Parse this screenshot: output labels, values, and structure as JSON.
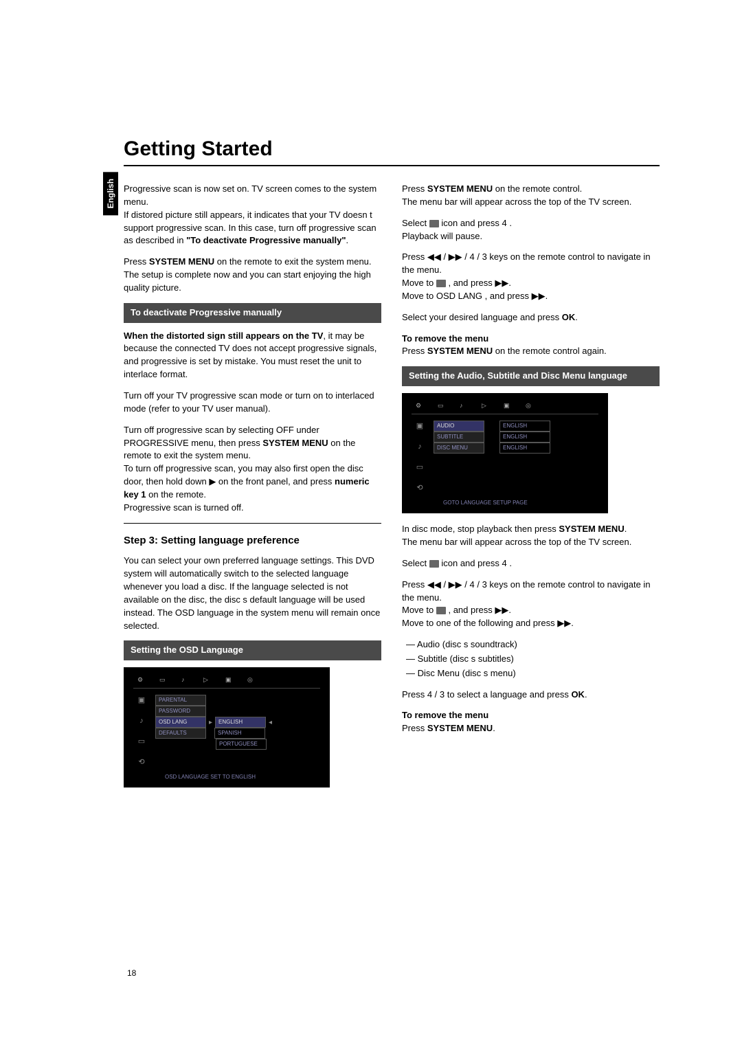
{
  "langTab": "English",
  "title": "Getting Started",
  "pageNumber": "18",
  "left": {
    "p1a": "Progressive scan is now set on. TV screen comes to the system menu.",
    "p1b": "If distored picture still appears, it indicates that your TV doesn t support progressive scan. In this case, turn off progressive scan as described in ",
    "p1b_bold": "\"To deactivate Progressive manually\"",
    "p1b_end": ".",
    "p2a": "Press ",
    "p2a_bold": "SYSTEM MENU",
    "p2a_end": " on the remote to exit the system menu.",
    "p2b": "The setup is complete now and you can start enjoying the high quality picture.",
    "sub1": "To deactivate Progressive manually",
    "p3_bold": "When the distorted sign still appears on the TV",
    "p3_end": ", it may be because the connected TV does not accept progressive signals, and progressive is set by mistake. You must reset the unit to interlace format.",
    "p4": "Turn off your TV progressive scan mode or turn on to interlaced mode (refer to your TV user manual).",
    "p5a": "Turn off progressive scan by selecting  OFF under PROGRESSIVE menu, then press ",
    "p5a_bold": "SYSTEM MENU",
    "p5a_end": " on the remote to exit the system menu.",
    "p5b": "To turn off progressive scan, you may also first open the disc door, then hold down ▶ on the front panel, and press ",
    "p5b_bold": "numeric key  1 ",
    "p5b_end": " on the remote.",
    "p5c": "Progressive scan is turned off.",
    "stepHeading": "Step 3:   Setting language preference",
    "p6": "You can select your own preferred language settings. This DVD system will automatically switch to the selected language whenever you load a disc. If the language selected is not available on the disc, the disc s default language will be used instead. The OSD language in the system menu will remain once selected.",
    "sub2": "Setting the OSD Language",
    "osd1": {
      "items": [
        "PARENTAL",
        "PASSWORD",
        "OSD LANG",
        "DEFAULTS"
      ],
      "options": [
        "ENGLISH",
        "SPANISH",
        "PORTUGUESE"
      ],
      "status": "OSD LANGUAGE SET TO ENGLISH"
    }
  },
  "right": {
    "p1a": "Press ",
    "p1a_bold": "SYSTEM MENU",
    "p1a_end": " on the remote control.",
    "p1b": "The menu bar will appear across the top of the TV screen.",
    "p2a": "Select ",
    "p2a_end": " icon and press 4 .",
    "p2b": "Playback will pause.",
    "p3a": "Press ◀◀ / ▶▶  / 4  / 3  keys on the remote control to navigate in the menu.",
    "p3b": "Move to  ",
    "p3b_end": " , and press ▶▶.",
    "p3c": "Move to  OSD LANG  , and press ▶▶.",
    "p4a": "Select your desired language and press ",
    "p4a_bold": "OK",
    "p4a_end": ".",
    "tr1_bold": "To remove the menu",
    "tr1a": "Press ",
    "tr1a_bold": "SYSTEM MENU",
    "tr1a_end": " on the remote control again.",
    "sub3": "Setting the Audio,  Subtitle and Disc Menu language",
    "osd2": {
      "items": [
        "AUDIO",
        "SUBTITLE",
        "DISC MENU"
      ],
      "vals": [
        "ENGLISH",
        "ENGLISH",
        "ENGLISH"
      ],
      "status": "GOTO LANGUAGE SETUP PAGE"
    },
    "p5a": "In disc mode, stop playback then press ",
    "p5a_bold": "SYSTEM MENU",
    "p5a_end": ".",
    "p5b": "The menu bar will appear across the top of the TV screen.",
    "p6a": "Select ",
    "p6a_end": " icon and press 4 .",
    "p7a": "Press ◀◀ / ▶▶  / 4  / 3  keys on the remote control to navigate in the menu.",
    "p7b": "Move to  ",
    "p7b_end": " , and press ▶▶.",
    "p7c": "Move to one of the following and press ▶▶.",
    "list": [
      "—  Audio  (disc s soundtrack)",
      "—  Subtitle  (disc s subtitles)",
      "—  Disc Menu  (disc s menu)"
    ],
    "p8a": "Press 4  / 3  to select a language and press ",
    "p8a_bold": "OK",
    "p8a_end": ".",
    "tr2_bold": "To remove the menu",
    "tr2a": "Press ",
    "tr2a_bold": "SYSTEM MENU",
    "tr2a_end": "."
  }
}
